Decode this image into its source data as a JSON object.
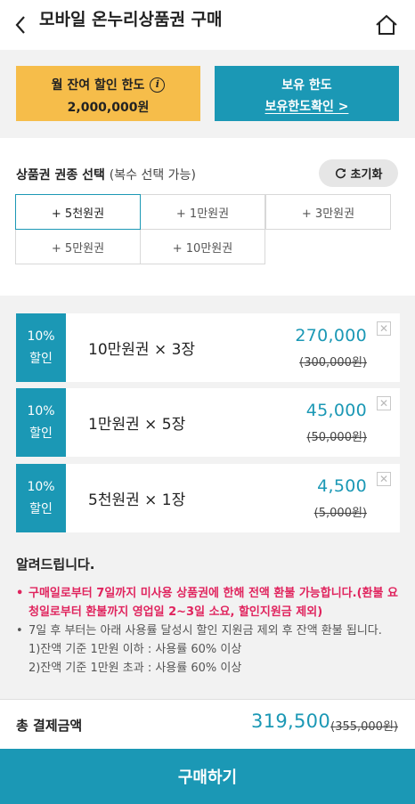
{
  "header": {
    "title": "모바일 온누리상품권 구매"
  },
  "limits": {
    "monthly_label": "월 잔여 할인 한도",
    "monthly_value": "2,000,000원",
    "owned_label": "보유 한도",
    "owned_link": "보유한도확인 >"
  },
  "select": {
    "title": "상품권 권종 선택",
    "subtitle": "(복수 선택 가능)",
    "reset_label": "초기화",
    "options": [
      "+ 5천원권",
      "+ 1만원권",
      "+ 3만원권",
      "+ 5만원권",
      "+ 10만원권"
    ],
    "active_index": 0
  },
  "cards": [
    {
      "discount": "10%",
      "discount_label": "할인",
      "name": "10만원권 × 3장",
      "price": "270,000",
      "original": "(300,000원)"
    },
    {
      "discount": "10%",
      "discount_label": "할인",
      "name": "1만원권 × 5장",
      "price": "45,000",
      "original": "(50,000원)"
    },
    {
      "discount": "10%",
      "discount_label": "할인",
      "name": "5천원권 × 1장",
      "price": "4,500",
      "original": "(5,000원)"
    }
  ],
  "notice": {
    "title": "알려드립니다.",
    "item1": "구매일로부터 7일까지 미사용 상품권에 한해 전액 환불 가능합니다.(환불 요청일로부터 환불까지 영업일 2~3일 소요, 할인지원금 제외)",
    "item2": "7일 후 부터는 아래 사용률 달성시 할인 지원금 제외 후 잔액 환불 됩니다.",
    "sub1": "1)잔액 기준 1만원 이하 : 사용률 60% 이상",
    "sub2": "2)잔액 기준 1만원 초과 : 사용률 60% 이상"
  },
  "total": {
    "label": "총 결제금액",
    "price": "319,500",
    "original": "(355,000원)"
  },
  "buy_label": "구매하기",
  "colors": {
    "accent": "#1b98b5",
    "yellow": "#f6bd4a",
    "notice_red": "#e0245e"
  }
}
